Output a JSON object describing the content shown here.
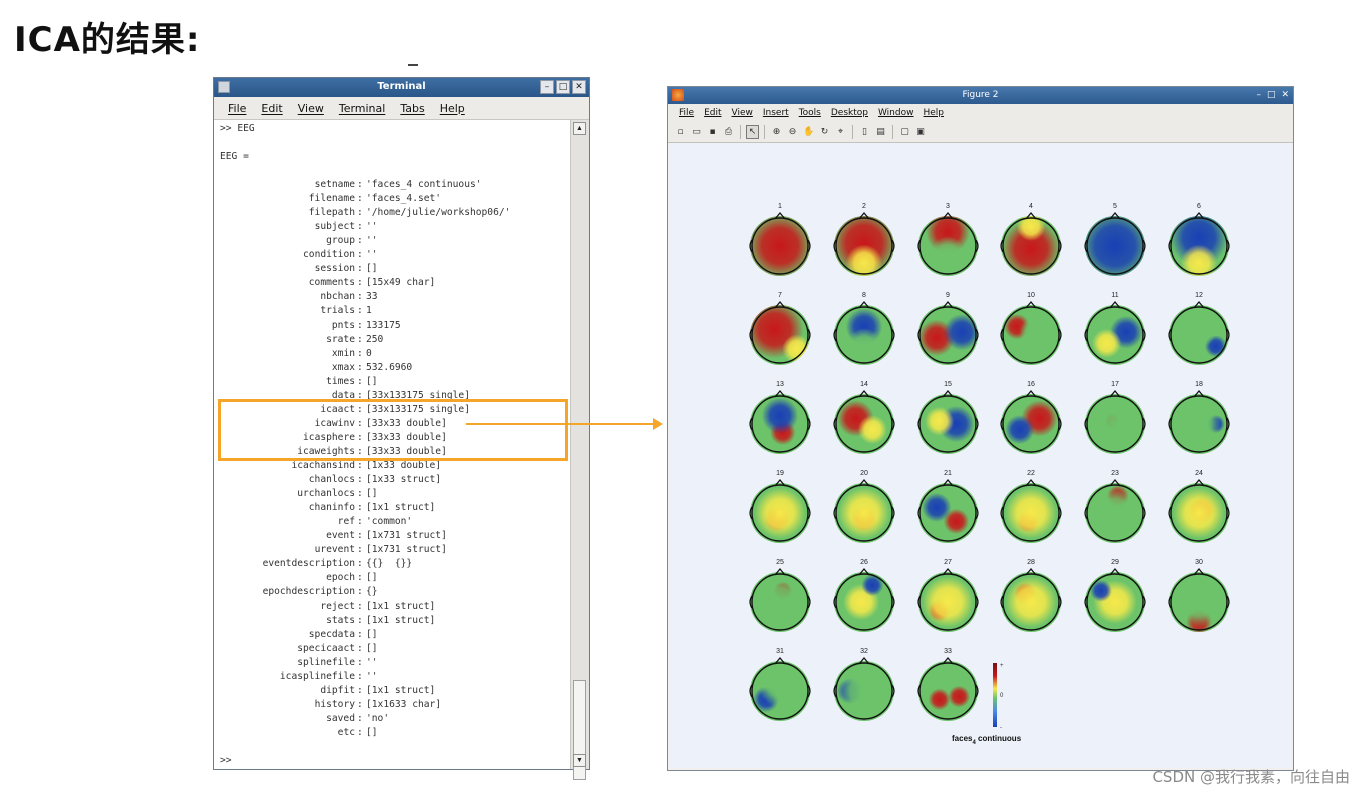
{
  "slide": {
    "title": "ICA的结果:",
    "watermark": "CSDN @我行我素，向往自由"
  },
  "terminal": {
    "title": "Terminal",
    "menu": [
      "File",
      "Edit",
      "View",
      "Terminal",
      "Tabs",
      "Help"
    ],
    "command": ">> EEG",
    "var_header": "EEG =",
    "prompt": ">>",
    "fields": [
      {
        "name": "setname",
        "value": "'faces_4 continuous'"
      },
      {
        "name": "filename",
        "value": "'faces_4.set'"
      },
      {
        "name": "filepath",
        "value": "'/home/julie/workshop06/'"
      },
      {
        "name": "subject",
        "value": "''"
      },
      {
        "name": "group",
        "value": "''"
      },
      {
        "name": "condition",
        "value": "''"
      },
      {
        "name": "session",
        "value": "[]"
      },
      {
        "name": "comments",
        "value": "[15x49 char]"
      },
      {
        "name": "nbchan",
        "value": "33"
      },
      {
        "name": "trials",
        "value": "1"
      },
      {
        "name": "pnts",
        "value": "133175"
      },
      {
        "name": "srate",
        "value": "250"
      },
      {
        "name": "xmin",
        "value": "0"
      },
      {
        "name": "xmax",
        "value": "532.6960"
      },
      {
        "name": "times",
        "value": "[]"
      },
      {
        "name": "data",
        "value": "[33x133175 single]"
      },
      {
        "name": "icaact",
        "value": "[33x133175 single]"
      },
      {
        "name": "icawinv",
        "value": "[33x33 double]"
      },
      {
        "name": "icasphere",
        "value": "[33x33 double]"
      },
      {
        "name": "icaweights",
        "value": "[33x33 double]"
      },
      {
        "name": "icachansind",
        "value": "[1x33 double]"
      },
      {
        "name": "chanlocs",
        "value": "[1x33 struct]"
      },
      {
        "name": "urchanlocs",
        "value": "[]"
      },
      {
        "name": "chaninfo",
        "value": "[1x1 struct]"
      },
      {
        "name": "ref",
        "value": "'common'"
      },
      {
        "name": "event",
        "value": "[1x731 struct]"
      },
      {
        "name": "urevent",
        "value": "[1x731 struct]"
      },
      {
        "name": "eventdescription",
        "value": "{{}  {}}"
      },
      {
        "name": "epoch",
        "value": "[]"
      },
      {
        "name": "epochdescription",
        "value": "{}"
      },
      {
        "name": "reject",
        "value": "[1x1 struct]"
      },
      {
        "name": "stats",
        "value": "[1x1 struct]"
      },
      {
        "name": "specdata",
        "value": "[]"
      },
      {
        "name": "specicaact",
        "value": "[]"
      },
      {
        "name": "splinefile",
        "value": "''"
      },
      {
        "name": "icasplinefile",
        "value": "''"
      },
      {
        "name": "dipfit",
        "value": "[1x1 struct]"
      },
      {
        "name": "history",
        "value": "[1x1633 char]"
      },
      {
        "name": "saved",
        "value": "'no'"
      },
      {
        "name": "etc",
        "value": "[]"
      }
    ]
  },
  "figure": {
    "title": "Figure 2",
    "menu": [
      "File",
      "Edit",
      "View",
      "Insert",
      "Tools",
      "Desktop",
      "Window",
      "Help"
    ],
    "toolbar_icons": [
      "new-icon",
      "open-icon",
      "save-icon",
      "print-icon",
      "pointer-icon",
      "zoom-in-icon",
      "zoom-out-icon",
      "pan-icon",
      "rotate-icon",
      "data-cursor-icon",
      "colorbar-icon",
      "legend-icon",
      "hide-plot-tools-icon",
      "show-plot-tools-icon"
    ],
    "component_labels": [
      "1",
      "2",
      "3",
      "4",
      "5",
      "6",
      "7",
      "8",
      "9",
      "10",
      "11",
      "12",
      "13",
      "14",
      "15",
      "16",
      "17",
      "18",
      "19",
      "20",
      "21",
      "22",
      "23",
      "24",
      "25",
      "26",
      "27",
      "28",
      "29",
      "30",
      "31",
      "32",
      "33"
    ],
    "colorbar_ticks": [
      "+",
      "0",
      "-"
    ],
    "caption": "faces",
    "caption_sub": "4",
    "caption_rest": " continuous",
    "colors": {
      "positive": "#c8171b",
      "neutral": "#f6e94a",
      "mid": "#6cc36a",
      "negative": "#1a3fb5"
    }
  }
}
